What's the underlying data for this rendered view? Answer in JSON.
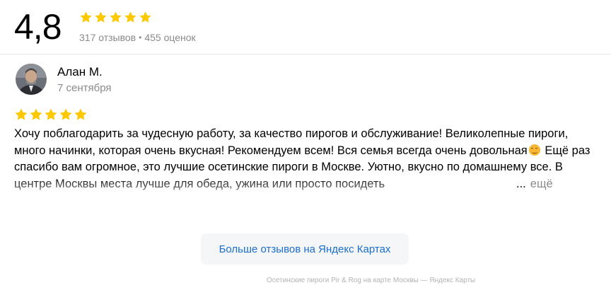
{
  "summary": {
    "rating": "4,8",
    "reviews_count": "317 отзывов",
    "separator": "•",
    "ratings_count": "455 оценок",
    "stars": 5
  },
  "review": {
    "author": "Алан М.",
    "date": "7 сентября",
    "stars": 5,
    "text_part1": "Хочу поблагодарить за чудесную работу, за качество пирогов и обслуживание! Великолепные пироги, много начинки, которая очень вкусная! Рекомендуем всем! Вся семья всегда очень довольная",
    "text_part2": " Ещё раз спасибо вам огромное, это лучшие осетинские пироги в Москве. Уютно, вкусно по домашнему все. В центре Москвы места лучше для обеда, ужина или просто посидеть",
    "ellipsis": "...",
    "more_label": "ещё",
    "emoji_icon": "smiling-face-icon"
  },
  "more_button": {
    "label": "Больше отзывов на Яндекс Картах"
  },
  "footer": {
    "text": "Осетинские пироги Pir & Rog на карте Москвы — Яндекс Карты"
  },
  "colors": {
    "star": "#fcc800",
    "link": "#1a6ecc",
    "muted": "#8a8a8a",
    "button_bg": "#f5f6f8"
  }
}
